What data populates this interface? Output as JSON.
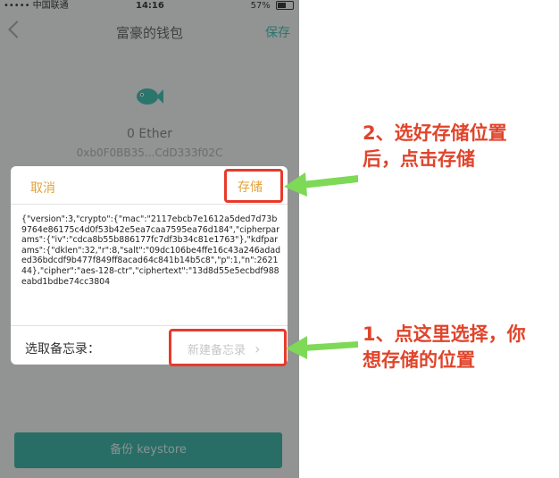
{
  "status_bar": {
    "carrier": "••••• 中国联通",
    "time": "14:16",
    "battery_percent": "57%",
    "battery_level": 0.57
  },
  "nav": {
    "title": "富豪的钱包",
    "save_label": "保存"
  },
  "wallet": {
    "balance": "0 Ether",
    "address": "0xb0F0BB35...CdD333f02C"
  },
  "dialog": {
    "cancel_label": "取消",
    "save_label": "存储",
    "keystore_text": "{\"version\":3,\"crypto\":{\"mac\":\"2117ebcb7e1612a5ded7d73b9764e86175c4d0f53b42e5ea7caa7595ea76d184\",\"cipherparams\":{\"iv\":\"cdca8b55b886177fc7df3b34c81e1763\"},\"kdfparams\":{\"dklen\":32,\"r\":8,\"salt\":\"09dc106be4ffe16c43a246adaded36bdcdf9b477f849ff8acad64c841b14b5c8\",\"p\":1,\"n\":262144},\"cipher\":\"aes-128-ctr\",\"ciphertext\":\"13d8d55e5ecbdf988eabd1bdbe74cc3804",
    "memo_label": "选取备忘录：",
    "memo_placeholder": "新建备忘录",
    "memo_chevron": "›"
  },
  "backup_button": {
    "label": "备份 keystore"
  },
  "annotations": {
    "step1": "1、点这里选择，你想存储的位置",
    "step2": "2、选好存储位置后，点击存储"
  },
  "colors": {
    "accent": "#2aa89a",
    "dialog_action": "#e3a23a",
    "annotation_red": "#e0442b",
    "arrow_green": "#7ed957"
  }
}
